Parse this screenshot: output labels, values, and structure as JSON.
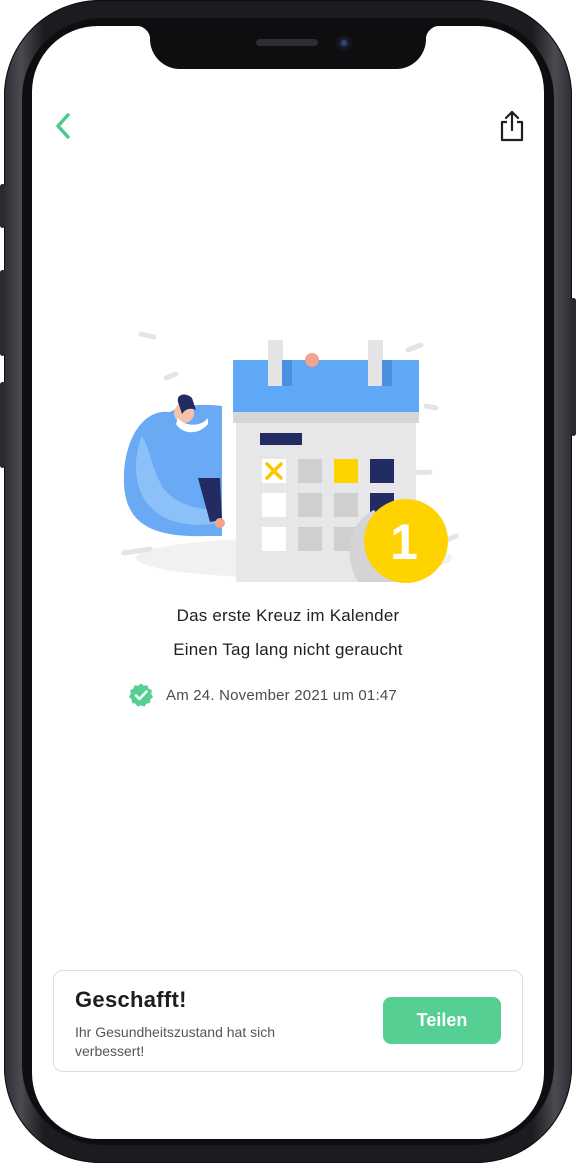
{
  "nav": {
    "back_icon": "chevron-left-icon",
    "share_icon": "share-icon"
  },
  "achievement": {
    "badge_number": "1",
    "title": "Das erste Kreuz im Kalender",
    "subtitle": "Einen Tag lang nicht geraucht",
    "verified_icon": "verified-check-icon",
    "date_text": "Am 24. November 2021 um 01:47"
  },
  "share_card": {
    "title": "Geschafft!",
    "description": "Ihr Gesundheitszustand hat sich verbessert!",
    "button_label": "Teilen"
  },
  "colors": {
    "accent_green": "#56cf93",
    "badge_yellow": "#ffd300",
    "calendar_blue": "#5ea8f7",
    "navy": "#232b63"
  }
}
